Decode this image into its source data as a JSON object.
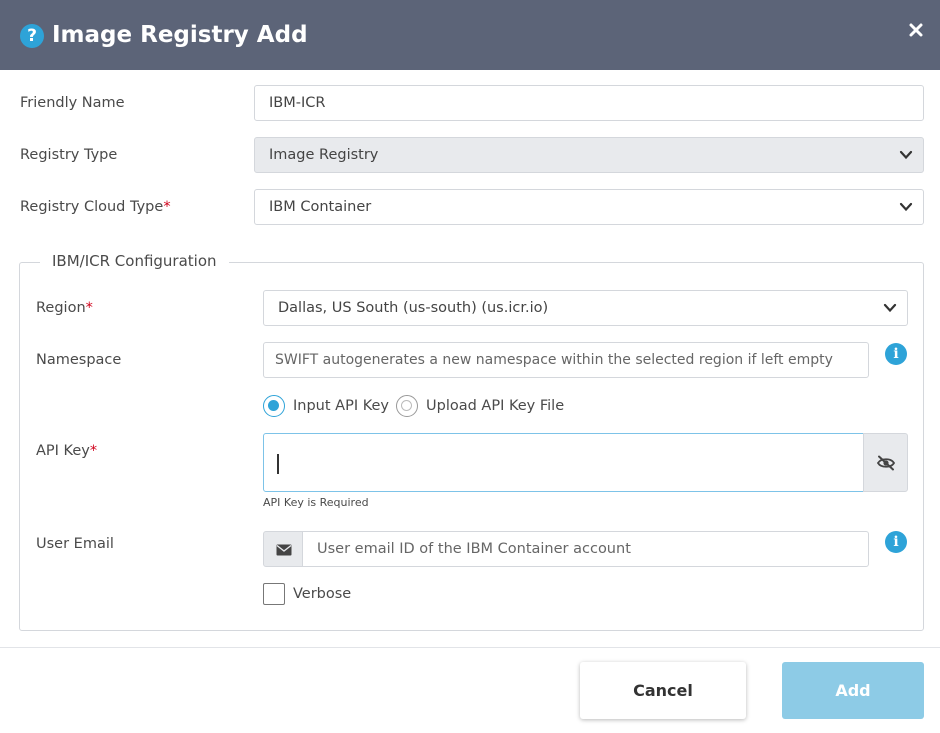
{
  "dialog": {
    "title": "Image Registry Add",
    "close_symbol": "×"
  },
  "form": {
    "friendly_name": {
      "label": "Friendly Name",
      "value": "IBM-ICR"
    },
    "registry_type": {
      "label": "Registry Type",
      "value": "Image Registry",
      "disabled": true
    },
    "registry_cloud_type": {
      "label": "Registry Cloud Type",
      "required_mark": "*",
      "value": "IBM Container"
    }
  },
  "config": {
    "legend": "IBM/ICR Configuration",
    "region": {
      "label": "Region",
      "required_mark": "*",
      "value": "Dallas, US South (us-south) (us.icr.io)"
    },
    "namespace": {
      "label": "Namespace",
      "placeholder": "SWIFT autogenerates a new namespace within the selected region if left empty"
    },
    "api_key_mode": {
      "options": [
        {
          "label": "Input API Key",
          "selected": true
        },
        {
          "label": "Upload API Key File",
          "selected": false
        }
      ]
    },
    "api_key": {
      "label": "API Key",
      "required_mark": "*",
      "value": "",
      "error": "API Key is Required"
    },
    "user_email": {
      "label": "User Email",
      "placeholder": "User email ID of the IBM Container account"
    },
    "verbose": {
      "label": "Verbose",
      "checked": false
    }
  },
  "footer": {
    "cancel_label": "Cancel",
    "add_label": "Add"
  },
  "icons": {
    "help": "help-icon",
    "info": "info-icon",
    "close": "close-icon",
    "chevron": "chevron-down-icon",
    "eye": "eye-slash-icon",
    "envelope": "envelope-icon"
  },
  "colors": {
    "header_bg": "#5c6478",
    "accent": "#2ea3d8",
    "required": "#d0021b",
    "add_button_disabled": "#8dcbe6"
  }
}
